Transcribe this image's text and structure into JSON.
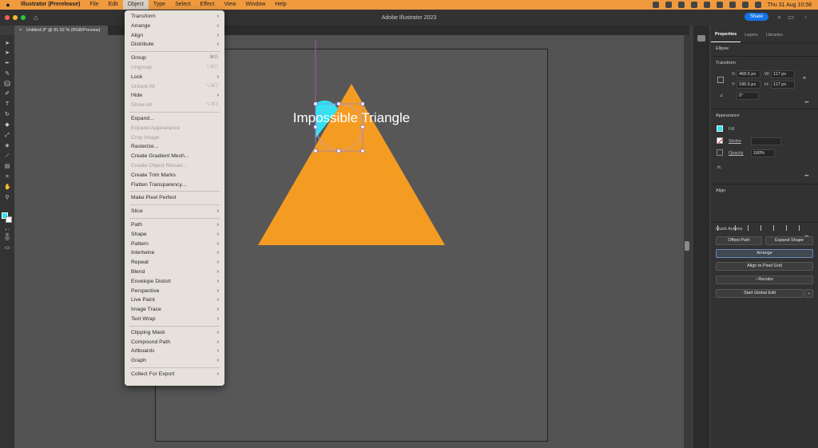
{
  "menubar": {
    "app_name": "Illustrator (Prerelease)",
    "items": [
      "File",
      "Edit",
      "Object",
      "Type",
      "Select",
      "Effect",
      "View",
      "Window",
      "Help"
    ],
    "active_item": "Object",
    "clock": "Thu 31 Aug  10:58"
  },
  "titlebar": {
    "title": "Adobe Illustrator 2023",
    "share_label": "Share"
  },
  "document": {
    "tab_label": "Untitled-3* @ 81.52 % (RGB/Preview)",
    "art_text": "Impossible Triangle",
    "triangle_color": "#f49c22",
    "circle_color": "#2ee4f2"
  },
  "object_menu": [
    {
      "label": "Transform",
      "submenu": true
    },
    {
      "label": "Arrange",
      "submenu": true
    },
    {
      "label": "Align",
      "submenu": true
    },
    {
      "label": "Distribute",
      "submenu": true
    },
    {
      "separator": true
    },
    {
      "label": "Group",
      "shortcut": "⌘G"
    },
    {
      "label": "Ungroup",
      "shortcut": "⇧⌘G",
      "disabled": true
    },
    {
      "label": "Lock",
      "submenu": true
    },
    {
      "label": "Unlock All",
      "shortcut": "⌥⌘2",
      "disabled": true
    },
    {
      "label": "Hide",
      "submenu": true
    },
    {
      "label": "Show All",
      "shortcut": "⌥⌘3",
      "disabled": true
    },
    {
      "separator": true
    },
    {
      "label": "Expand..."
    },
    {
      "label": "Expand Appearance",
      "disabled": true
    },
    {
      "label": "Crop Image",
      "disabled": true
    },
    {
      "label": "Rasterize..."
    },
    {
      "label": "Create Gradient Mesh..."
    },
    {
      "label": "Create Object Mosaic...",
      "disabled": true
    },
    {
      "label": "Create Trim Marks"
    },
    {
      "label": "Flatten Transparency..."
    },
    {
      "separator": true
    },
    {
      "label": "Make Pixel Perfect"
    },
    {
      "separator": true
    },
    {
      "label": "Slice",
      "submenu": true
    },
    {
      "separator": true
    },
    {
      "label": "Path",
      "submenu": true
    },
    {
      "label": "Shape",
      "submenu": true
    },
    {
      "label": "Pattern",
      "submenu": true
    },
    {
      "label": "Intertwine",
      "submenu": true
    },
    {
      "label": "Repeat",
      "submenu": true
    },
    {
      "label": "Blend",
      "submenu": true
    },
    {
      "label": "Envelope Distort",
      "submenu": true
    },
    {
      "label": "Perspective",
      "submenu": true
    },
    {
      "label": "Live Paint",
      "submenu": true
    },
    {
      "label": "Image Trace",
      "submenu": true
    },
    {
      "label": "Text Wrap",
      "submenu": true
    },
    {
      "separator": true
    },
    {
      "label": "Clipping Mask",
      "submenu": true
    },
    {
      "label": "Compound Path",
      "submenu": true
    },
    {
      "label": "Artboards",
      "submenu": true
    },
    {
      "label": "Graph",
      "submenu": true
    },
    {
      "separator": true
    },
    {
      "label": "Collect For Export",
      "submenu": true
    }
  ],
  "properties": {
    "tabs": [
      "Properties",
      "Layers",
      "Libraries"
    ],
    "object_type": "Ellipse",
    "transform_title": "Transform",
    "x_label": "X:",
    "x_value": "468.5 px",
    "y_label": "Y:",
    "y_value": "196.5 px",
    "w_label": "W:",
    "w_value": "117 px",
    "h_label": "H:",
    "h_value": "117 px",
    "rotation": "0°",
    "appearance_title": "Appearance",
    "fill_label": "Fill",
    "fill_color": "#2ee4f2",
    "stroke_label": "Stroke",
    "opacity_label": "Opacity",
    "opacity_value": "100%",
    "fx_label": "fx.",
    "align_title": "Align",
    "quick_actions_title": "Quick Actions",
    "offset_path": "Offset Path",
    "expand_shape": "Expand Shape",
    "arrange": "Arrange",
    "align_pixel_grid": "Align to Pixel Grid",
    "recolor": "Recolor",
    "start_global_edit": "Start Global Edit",
    "accent_color": "#1473e6"
  }
}
